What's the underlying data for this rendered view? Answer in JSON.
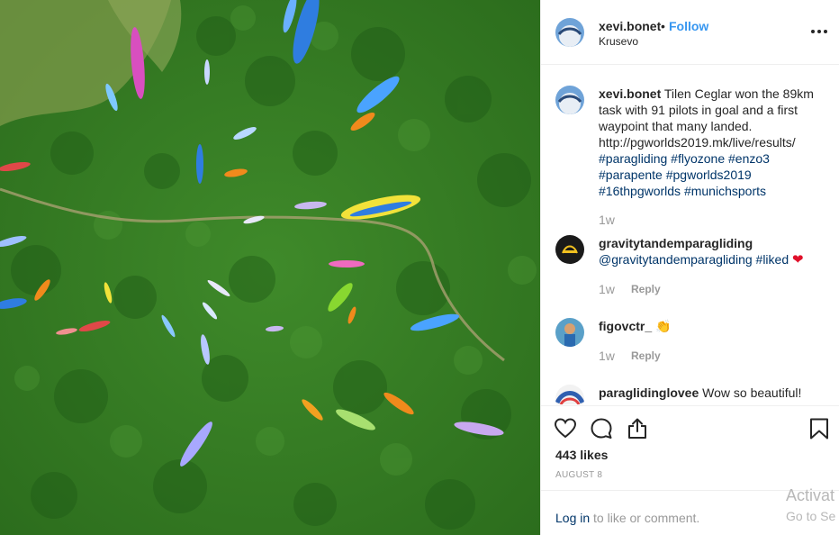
{
  "post": {
    "username": "xevi.bonet",
    "separator": "•",
    "follow_label": "Follow",
    "location": "Krusevo",
    "photo_alt": "Aerial view of paragliders over a green forest",
    "more_icon": "more-options-icon"
  },
  "comments": [
    {
      "username": "xevi.bonet",
      "text": "Tilen Ceglar won the 89km task with 91 pilots in goal and a first waypoint that many landed.",
      "link": "http://pgworlds2019.mk/live/results/",
      "hashtags_line1": "#paragliding #flyozone #enzo3",
      "hashtags_line2": "#parapente #pgworlds2019",
      "hashtags_line3": "#16thpgworlds #munichsports",
      "age": "1w"
    },
    {
      "username": "gravitytandemparagliding",
      "mention": "@gravitytandemparagliding",
      "hashtag": "#liked",
      "emoji": "❤",
      "age": "1w",
      "reply_label": "Reply"
    },
    {
      "username": "figovctr_",
      "emoji": "👏",
      "age": "1w",
      "reply_label": "Reply"
    },
    {
      "username": "paraglidinglovee",
      "text": "Wow so beautiful!"
    }
  ],
  "actions": {
    "like_icon": "heart-outline-icon",
    "comment_icon": "comment-bubble-icon",
    "share_icon": "share-upload-icon",
    "save_icon": "bookmark-icon"
  },
  "likes": "443 likes",
  "date": "AUGUST 8",
  "login": {
    "link": "Log in",
    "rest": " to like or comment."
  },
  "watermark": {
    "line1": "Activat",
    "line2": "Go to Se"
  },
  "colors": {
    "link_blue": "#3897f0",
    "hashtag_blue": "#003569",
    "muted": "#999999",
    "heart_red": "#e0102a"
  }
}
